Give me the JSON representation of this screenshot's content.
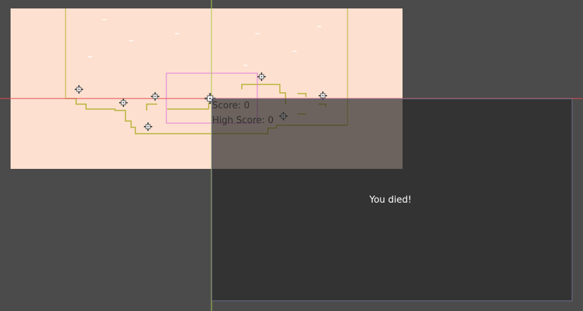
{
  "editor": {
    "game_view": {
      "background": "#fde0cf"
    },
    "terrain": {
      "color": "#b5b236"
    },
    "selection_box": {
      "color": "#e377dd"
    },
    "axes": {
      "x_axis_color": "#e04a55",
      "y_axis_color": "#a8c94a",
      "viewport_border_color": "#b9a5d6"
    },
    "markers": {
      "icon": "move-handle-icon",
      "count": 9
    }
  },
  "hud": {
    "score_label": "Score: 0",
    "high_score_label": "High Score: 0"
  },
  "overlay": {
    "death_message": "You died!"
  }
}
